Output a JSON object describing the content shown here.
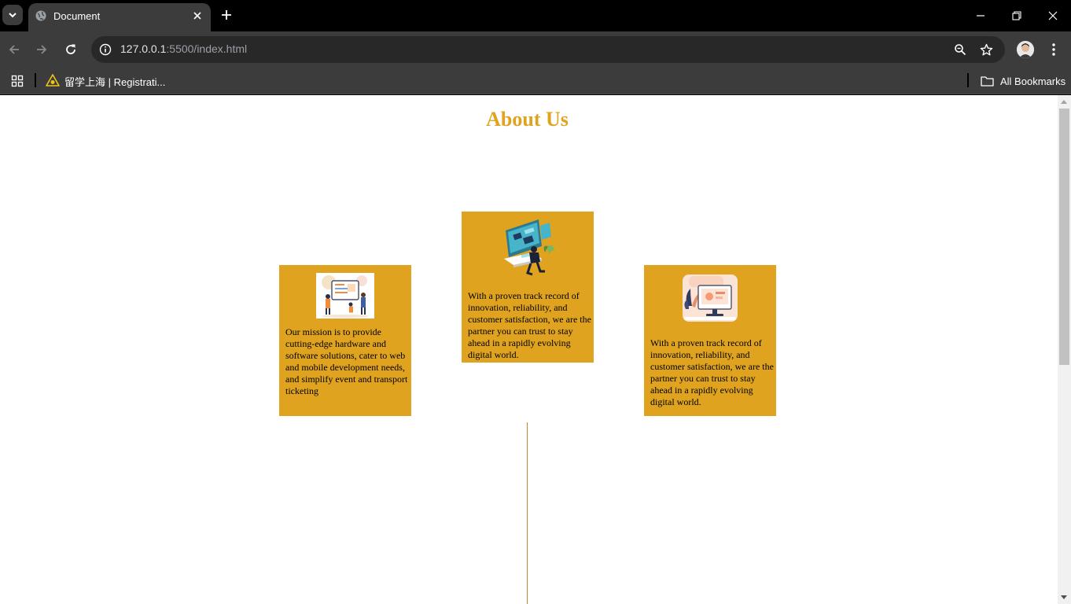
{
  "browser": {
    "tab_title": "Document",
    "url_host": "127.0.0.1",
    "url_rest": ":5500/index.html",
    "bookmarks": [
      {
        "label": "留学上海 | Registrati..."
      }
    ],
    "all_bookmarks_label": "All Bookmarks"
  },
  "page": {
    "title": "About Us",
    "accent_color": "#dfa320",
    "cards": [
      {
        "image": "team-whiteboard-illustration",
        "text": "Our mission is to provide cutting-edge hardware and software solutions, cater to web and mobile development needs, and simplify event and transport ticketing"
      },
      {
        "image": "developer-at-desk-illustration",
        "text": "With a proven track record of innovation, reliability, and customer satisfaction, we are the partner you can trust to stay ahead in a rapidly evolving digital world."
      },
      {
        "image": "monitor-plants-illustration",
        "text": "With a proven track record of innovation, reliability, and customer satisfaction, we are the partner you can trust to stay ahead in a rapidly evolving digital world."
      }
    ]
  }
}
